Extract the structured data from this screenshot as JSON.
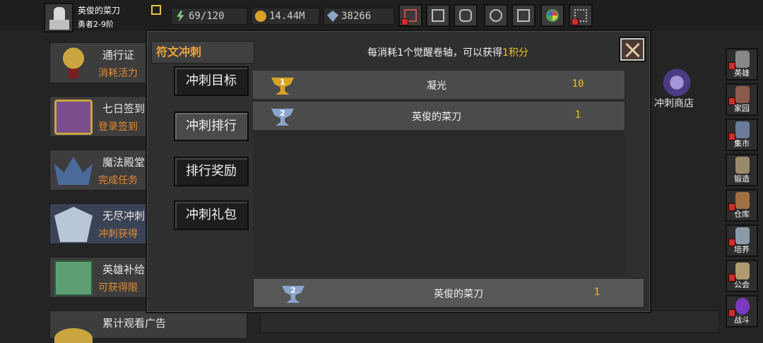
{
  "player": {
    "name": "英俊的菜刀",
    "level": "勇者2-9阶"
  },
  "resources": {
    "energy": "69/120",
    "gold": "14.44M",
    "gems": "38266"
  },
  "top_icons": [
    "shop-cart-icon",
    "mail-icon",
    "gamepad-icon",
    "settings-gear-icon",
    "gift-icon",
    "color-wheel-icon",
    "firework-icon"
  ],
  "features": [
    {
      "title": "通行证",
      "subtitle": "消耗活力",
      "icon": "golden-cup-icon"
    },
    {
      "title": "七日签到",
      "subtitle": "登录签到",
      "icon": "treasure-chest-icon"
    },
    {
      "title": "魔法殿堂",
      "subtitle": "完成任务",
      "icon": "crystal-crown-icon"
    },
    {
      "title": "无尽冲刺",
      "subtitle": "冲刺获得",
      "icon": "armor-icon"
    },
    {
      "title": "英雄补给",
      "subtitle": "可获得限",
      "icon": "supply-crate-icon"
    },
    {
      "title": "累计观看广告",
      "subtitle": "",
      "icon": "coin-icon"
    }
  ],
  "side_nav": [
    "英雄",
    "家园",
    "集市",
    "锻造",
    "仓库",
    "培养",
    "公会",
    "战斗"
  ],
  "behind": {
    "shop_label": "冲刺商店"
  },
  "dialog": {
    "title": "符文冲刺",
    "info_prefix": "每消耗1个觉醒卷轴，可以获得",
    "info_highlight": "1积分",
    "tabs": [
      "冲刺目标",
      "冲刺排行",
      "排行奖励",
      "冲刺礼包"
    ],
    "active_tab": "冲刺排行",
    "ranking": [
      {
        "rank": "1",
        "name": "凝光",
        "score": "10",
        "medal": "gold"
      },
      {
        "rank": "2",
        "name": "英俊的菜刀",
        "score": "1",
        "medal": "silver"
      }
    ],
    "my_rank": {
      "rank": "2",
      "name": "英俊的菜刀",
      "score": "1",
      "medal": "silver"
    }
  },
  "colors": {
    "accent_orange": "#f0a33a",
    "score_yellow": "#f0c020",
    "alert_red": "#c9302c"
  }
}
